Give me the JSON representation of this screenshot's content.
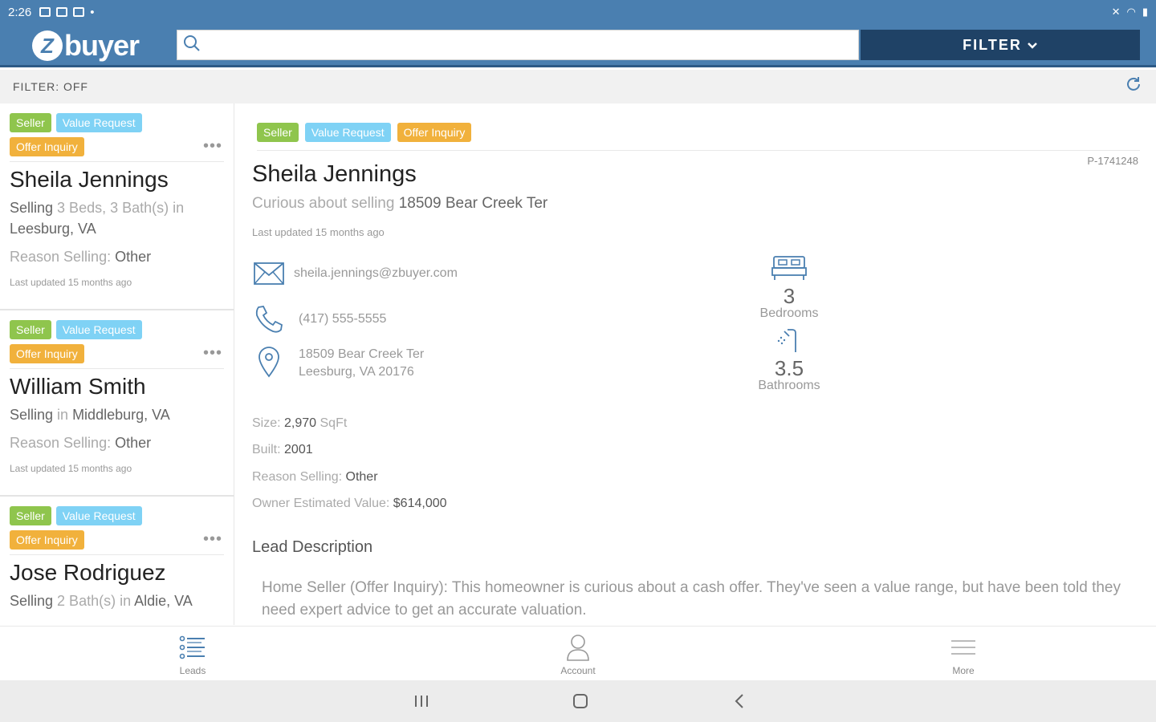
{
  "status_bar": {
    "time": "2:26"
  },
  "app": {
    "logo_text": "buyer",
    "logo_mark": "Z",
    "brand_color": "#4a7fb0",
    "dark_color": "#1f4266"
  },
  "search": {
    "placeholder": ""
  },
  "filter_button": {
    "label": "FILTER"
  },
  "filter_bar": {
    "label": "FILTER: OFF"
  },
  "tag_colors": {
    "seller": "#8fc54d",
    "value_request": "#7fd2f5",
    "offer_inquiry": "#f1b13c"
  },
  "leads": [
    {
      "tags": [
        "Seller",
        "Value Request",
        "Offer Inquiry"
      ],
      "name": "Sheila Jennings",
      "selling_prefix": "Selling",
      "selling_detail": " 3 Beds, 3 Bath(s) in ",
      "selling_location": "Leesburg, VA",
      "reason_label": "Reason Selling: ",
      "reason_value": "Other",
      "updated": "Last updated 15 months ago"
    },
    {
      "tags": [
        "Seller",
        "Value Request",
        "Offer Inquiry"
      ],
      "name": "William Smith",
      "selling_prefix": "Selling",
      "selling_detail": " in ",
      "selling_location": "Middleburg, VA",
      "reason_label": "Reason Selling: ",
      "reason_value": "Other",
      "updated": "Last updated 15 months ago"
    },
    {
      "tags": [
        "Seller",
        "Value Request",
        "Offer Inquiry"
      ],
      "name": "Jose Rodriguez",
      "selling_prefix": "Selling",
      "selling_detail": " 2 Bath(s) in ",
      "selling_location": "Aldie, VA",
      "reason_label": "",
      "reason_value": "",
      "updated": ""
    }
  ],
  "detail": {
    "tags": [
      "Seller",
      "Value Request",
      "Offer Inquiry"
    ],
    "id": "P-1741248",
    "name": "Sheila Jennings",
    "curious_label": "Curious about selling ",
    "address_short": "18509 Bear Creek Ter",
    "updated": "Last updated 15 months ago",
    "email": "sheila.jennings@zbuyer.com",
    "phone": "(417) 555-5555",
    "address_line1": "18509 Bear Creek Ter",
    "address_line2": "Leesburg, VA 20176",
    "bedrooms": "3",
    "bedrooms_label": "Bedrooms",
    "bathrooms": "3.5",
    "bathrooms_label": "Bathrooms",
    "size_label": "Size: ",
    "size_value": "2,970",
    "size_unit": " SqFt",
    "built_label": "Built: ",
    "built_value": "2001",
    "reason_label": "Reason Selling: ",
    "reason_value": "Other",
    "value_label": "Owner Estimated Value: ",
    "value_value": "$614,000",
    "description_title": "Lead Description",
    "description": "Home Seller (Offer Inquiry): This homeowner is curious about a cash offer. They've seen a value range, but have been told they need expert advice to get an accurate valuation."
  },
  "tabs": [
    {
      "label": "Leads",
      "icon": "list-icon"
    },
    {
      "label": "Account",
      "icon": "person-icon"
    },
    {
      "label": "More",
      "icon": "menu-icon"
    }
  ]
}
